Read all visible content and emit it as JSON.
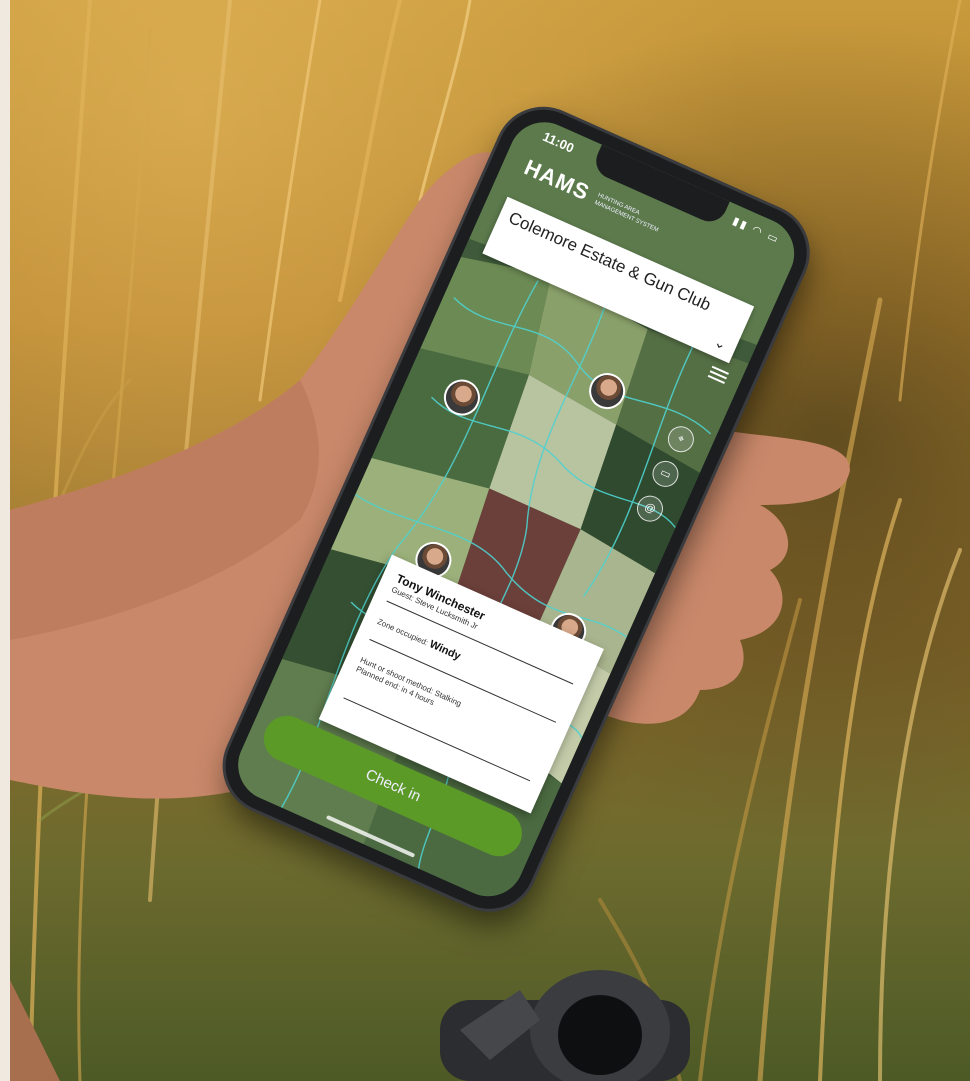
{
  "status_bar": {
    "time": "11:00",
    "icons": "▮▮ ◠ ▭"
  },
  "app": {
    "logo_word": "HAMS",
    "logo_sub": "HUNTING AREA MANAGEMENT SYSTEM",
    "estate_name": "Colemore Estate & Gun Club",
    "estate_chevron": "⌄"
  },
  "map_controls": [
    "⌖",
    "▭",
    "@"
  ],
  "card": {
    "name": "Tony Winchester",
    "guest": "Guest: Steve Lucksmith Jr",
    "zone_label": "Zone occupied:",
    "zone_value": "Windy",
    "method": "Hunt or shoot method: Stalking",
    "planned_end": "Planned end: in 4 hours"
  },
  "checkin_label": "Check in",
  "colors": {
    "accent_green": "#5c9a28",
    "map_line": "#4fd2cf"
  }
}
